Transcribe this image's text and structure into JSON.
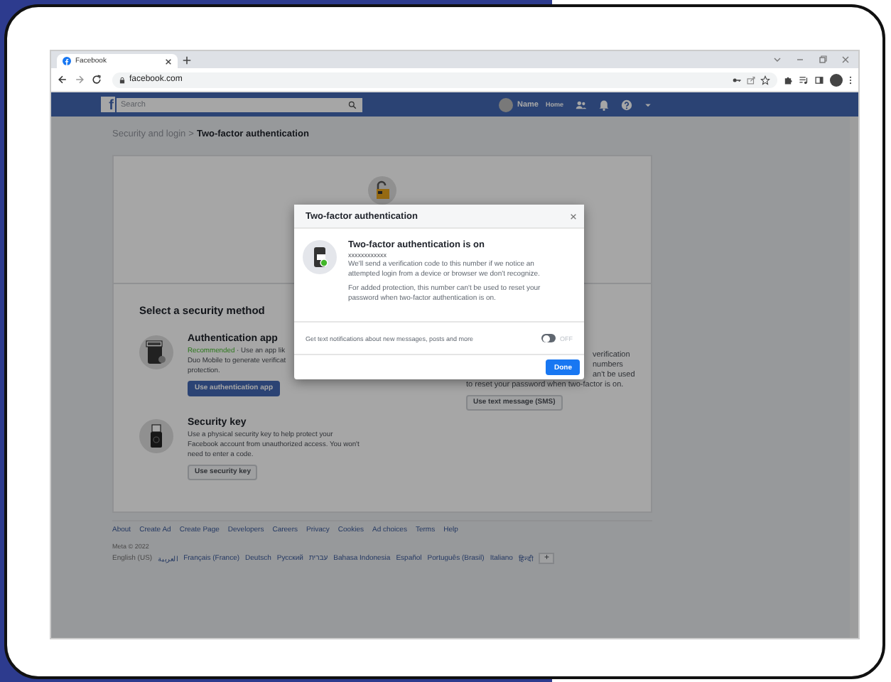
{
  "browser": {
    "tab_title": "Facebook",
    "url": "facebook.com"
  },
  "fb_bar": {
    "logo": "f",
    "search_placeholder": "Search",
    "profile_name": "Name",
    "home": "Home"
  },
  "breadcrumb": {
    "parent": "Security and login",
    "separator": ">",
    "current": "Two-factor authentication"
  },
  "methods_heading": "Select a security method",
  "methods": [
    {
      "kind": "app",
      "title": "Authentication app",
      "lines": [
        {
          "highlight": "Recommended",
          "text": " · Use an app lik"
        },
        {
          "text": "Duo Mobile to generate verificat"
        },
        {
          "text": "protection."
        }
      ],
      "button": "Use authentication app",
      "primary": true
    },
    {
      "kind": "key",
      "title": "Security key",
      "lines": [
        {
          "text": "Use a physical security key to help protect your"
        },
        {
          "text": "Facebook account from unauthorized access. You won't"
        },
        {
          "text": "need to enter a code."
        }
      ],
      "button": "Use security key",
      "primary": false
    }
  ],
  "sms": {
    "cut_lines": [
      "verification",
      "numbers",
      "an't be used"
    ],
    "line": "to reset your password when two-factor is on.",
    "button": "Use text message (SMS)"
  },
  "footer": {
    "links": [
      "About",
      "Create Ad",
      "Create Page",
      "Developers",
      "Careers",
      "Privacy",
      "Cookies",
      "Ad choices",
      "Terms",
      "Help"
    ],
    "copyright": "Meta © 2022",
    "languages": [
      "English (US)",
      "العربية",
      "Français (France)",
      "Deutsch",
      "Русский",
      "עברית",
      "Bahasa Indonesia",
      "Español",
      "Português (Brasil)",
      "Italiano",
      "हिन्दी"
    ],
    "more": "+"
  },
  "modal": {
    "title": "Two-factor authentication",
    "heading": "Two-factor authentication is on",
    "number": "xxxxxxxxxxxx",
    "paragraphs": [
      "We'll send a verification code to this number if we notice an attempted login from a device or browser we don't recognize.",
      "For added protection, this number can't be used to reset your password when two-factor authentication is on."
    ],
    "toggle": {
      "label": "Get text notifications about new messages, posts and more",
      "on": false,
      "state_text": "OFF"
    },
    "done": "Done"
  }
}
